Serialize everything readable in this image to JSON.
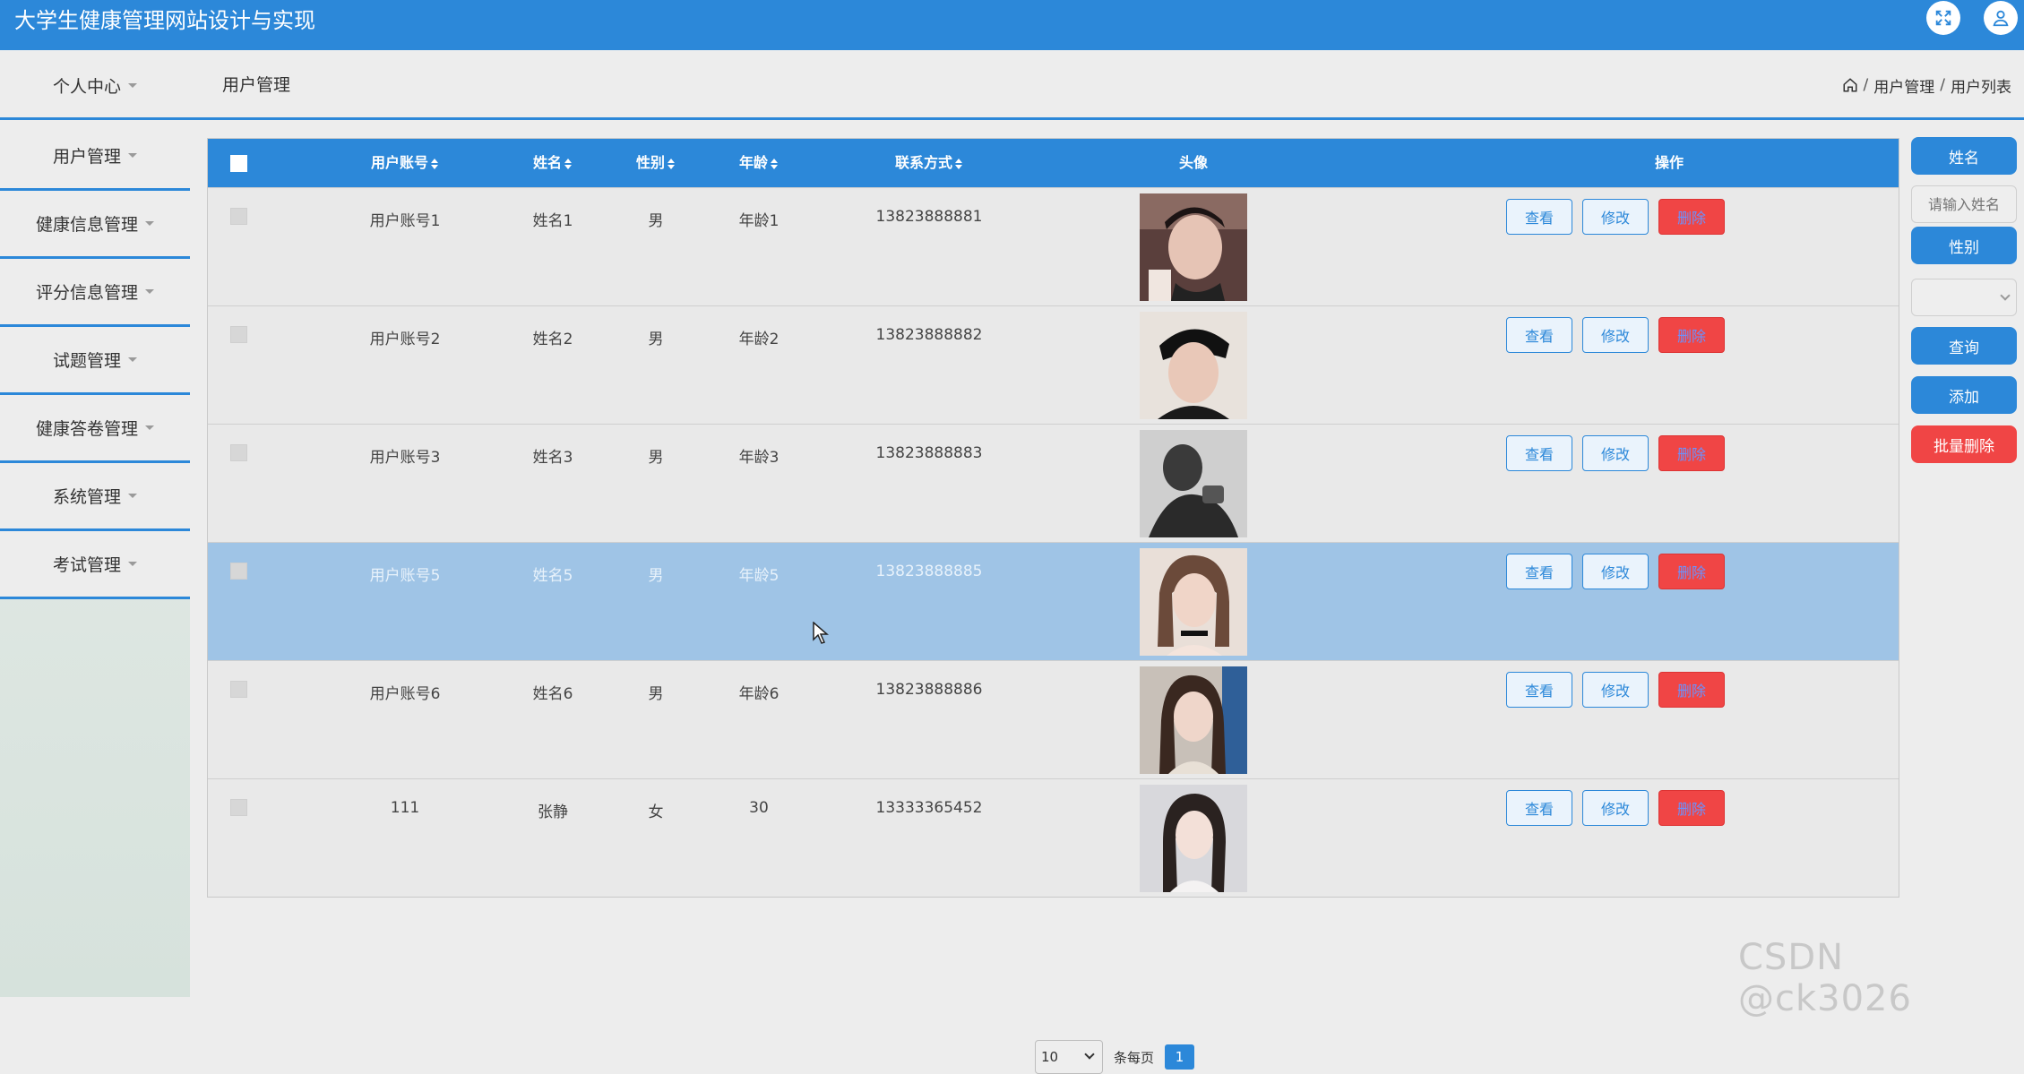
{
  "app_title": "大学生健康管理网站设计与实现",
  "header": {
    "fullscreen_icon": "expand-icon",
    "user_icon": "user-icon"
  },
  "subbar": {
    "personal_center": "个人中心",
    "section_title": "用户管理",
    "breadcrumb": {
      "home_icon": "home-icon",
      "items": [
        "用户管理",
        "用户列表"
      ],
      "separator": "/"
    }
  },
  "sidebar": {
    "items": [
      "用户管理",
      "健康信息管理",
      "评分信息管理",
      "试题管理",
      "健康答卷管理",
      "系统管理",
      "考试管理"
    ]
  },
  "table": {
    "columns": [
      "用户账号",
      "姓名",
      "性别",
      "年龄",
      "联系方式",
      "头像",
      "操作"
    ],
    "actions": {
      "view": "查看",
      "edit": "修改",
      "delete": "删除"
    },
    "rows": [
      {
        "account": "用户账号1",
        "name": "姓名1",
        "gender": "男",
        "age": "年龄1",
        "phone": "13823888881",
        "selected": false
      },
      {
        "account": "用户账号2",
        "name": "姓名2",
        "gender": "男",
        "age": "年龄2",
        "phone": "13823888882",
        "selected": false
      },
      {
        "account": "用户账号3",
        "name": "姓名3",
        "gender": "男",
        "age": "年龄3",
        "phone": "13823888883",
        "selected": false
      },
      {
        "account": "用户账号5",
        "name": "姓名5",
        "gender": "男",
        "age": "年龄5",
        "phone": "13823888885",
        "selected": true
      },
      {
        "account": "用户账号6",
        "name": "姓名6",
        "gender": "男",
        "age": "年龄6",
        "phone": "13823888886",
        "selected": false
      },
      {
        "account": "111",
        "name": "张静",
        "gender": "女",
        "age": "30",
        "phone": "13333365452",
        "selected": false
      }
    ]
  },
  "search_panel": {
    "name_label": "姓名",
    "name_placeholder": "请输入姓名",
    "gender_label": "性别",
    "gender_value": "",
    "query_button": "查询",
    "add_button": "添加",
    "batch_delete_button": "批量删除"
  },
  "pagination": {
    "page_size": "10",
    "per_page_label": "条每页",
    "current_page": "1"
  },
  "watermark": "CSDN @ck3026",
  "colors": {
    "primary": "#2c88d9",
    "danger": "#f04545",
    "selected_row": "#9fc4e6"
  }
}
